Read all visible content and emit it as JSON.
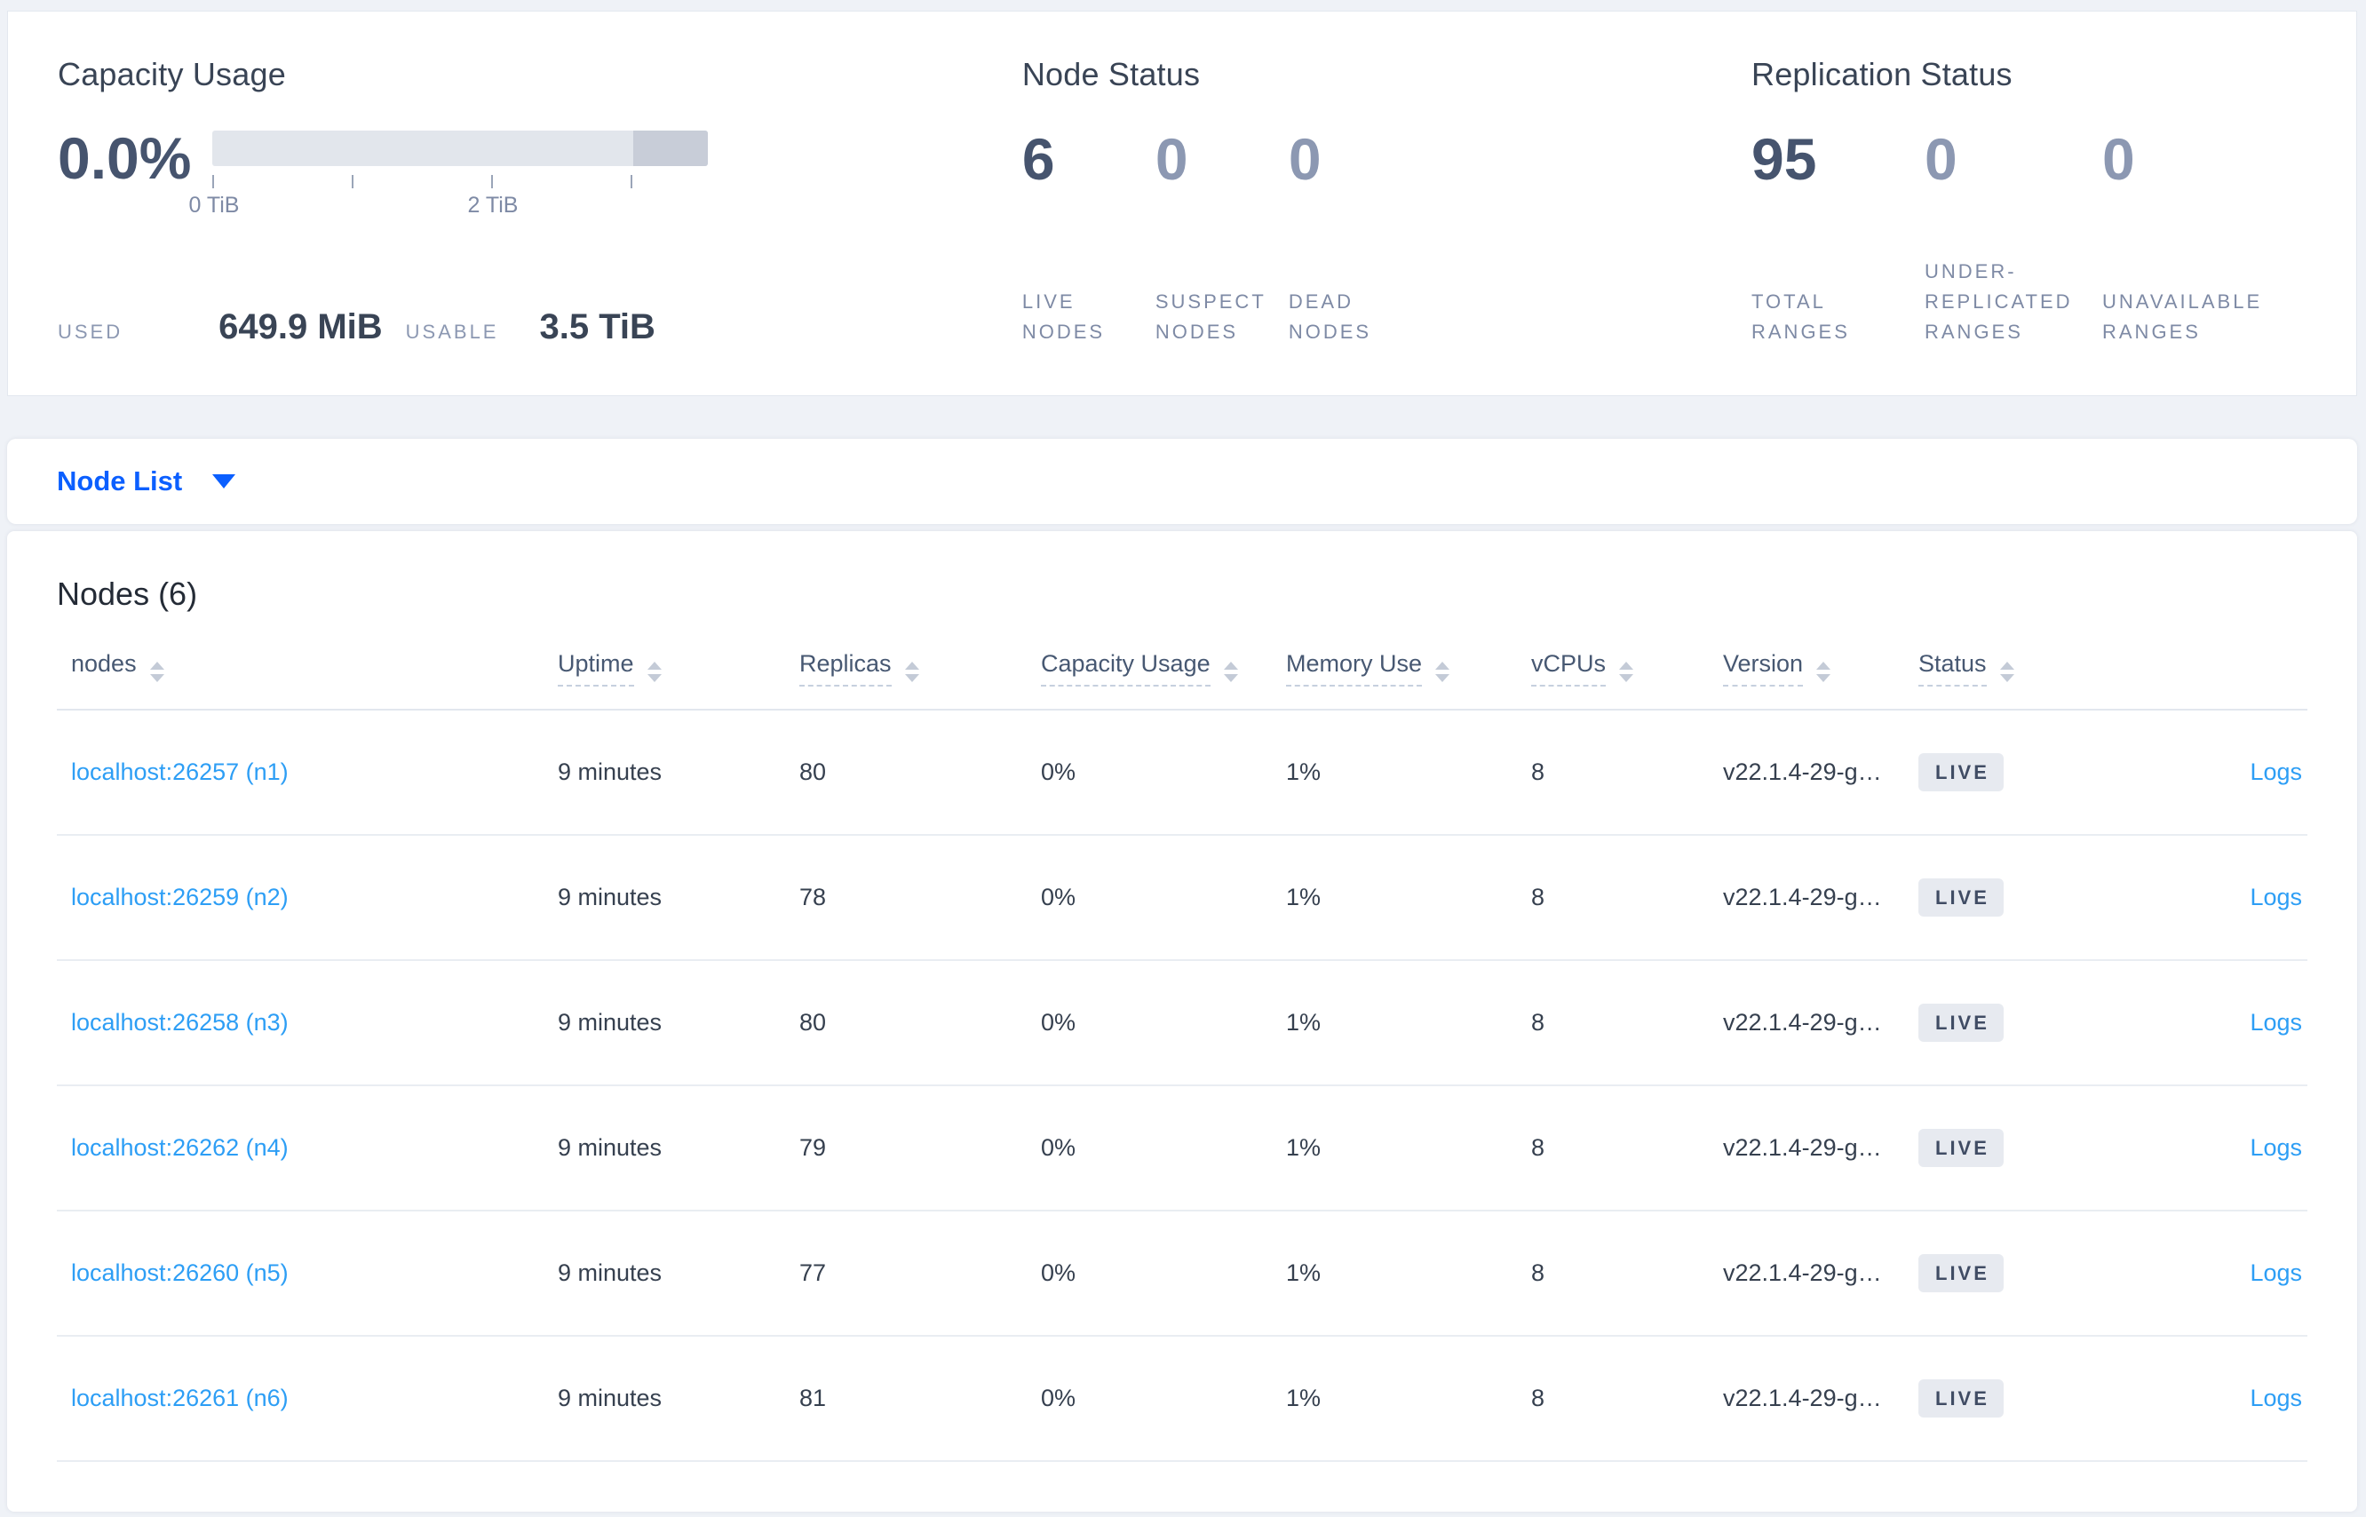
{
  "summary": {
    "capacity": {
      "title": "Capacity Usage",
      "percent": "0.0%",
      "tick_labels": {
        "t0": "0 TiB",
        "t2": "2 TiB"
      },
      "used_label": "USED",
      "used_value": "649.9 MiB",
      "usable_label": "USABLE",
      "usable_value": "3.5 TiB"
    },
    "node_status": {
      "title": "Node Status",
      "stats": [
        {
          "value": "6",
          "label": "LIVE NODES"
        },
        {
          "value": "0",
          "label": "SUSPECT NODES"
        },
        {
          "value": "0",
          "label": "DEAD NODES"
        }
      ]
    },
    "replication": {
      "title": "Replication Status",
      "stats": [
        {
          "value": "95",
          "label": "TOTAL RANGES"
        },
        {
          "value": "0",
          "label": "UNDER-REPLICATED RANGES"
        },
        {
          "value": "0",
          "label": "UNAVAILABLE RANGES"
        }
      ]
    }
  },
  "view_selector": {
    "label": "Node List"
  },
  "table": {
    "title": "Nodes (6)",
    "columns": [
      "nodes",
      "Uptime",
      "Replicas",
      "Capacity Usage",
      "Memory Use",
      "vCPUs",
      "Version",
      "Status"
    ],
    "rows": [
      {
        "node": "localhost:26257 (n1)",
        "uptime": "9 minutes",
        "replicas": "80",
        "capacity": "0%",
        "memory": "1%",
        "vcpus": "8",
        "version": "v22.1.4-29-g…",
        "status": "LIVE",
        "logs": "Logs"
      },
      {
        "node": "localhost:26259 (n2)",
        "uptime": "9 minutes",
        "replicas": "78",
        "capacity": "0%",
        "memory": "1%",
        "vcpus": "8",
        "version": "v22.1.4-29-g…",
        "status": "LIVE",
        "logs": "Logs"
      },
      {
        "node": "localhost:26258 (n3)",
        "uptime": "9 minutes",
        "replicas": "80",
        "capacity": "0%",
        "memory": "1%",
        "vcpus": "8",
        "version": "v22.1.4-29-g…",
        "status": "LIVE",
        "logs": "Logs"
      },
      {
        "node": "localhost:26262 (n4)",
        "uptime": "9 minutes",
        "replicas": "79",
        "capacity": "0%",
        "memory": "1%",
        "vcpus": "8",
        "version": "v22.1.4-29-g…",
        "status": "LIVE",
        "logs": "Logs"
      },
      {
        "node": "localhost:26260 (n5)",
        "uptime": "9 minutes",
        "replicas": "77",
        "capacity": "0%",
        "memory": "1%",
        "vcpus": "8",
        "version": "v22.1.4-29-g…",
        "status": "LIVE",
        "logs": "Logs"
      },
      {
        "node": "localhost:26261 (n6)",
        "uptime": "9 minutes",
        "replicas": "81",
        "capacity": "0%",
        "memory": "1%",
        "vcpus": "8",
        "version": "v22.1.4-29-g…",
        "status": "LIVE",
        "logs": "Logs"
      }
    ]
  },
  "colors": {
    "accent_blue": "#0b5fff",
    "link_blue": "#2d9ef5",
    "heading_slate": "#394455",
    "stat_emphasis": "#46546e",
    "stat_muted": "#8c98b2",
    "label_gray": "#7e8aa5",
    "badge_bg": "#e7eaf0",
    "badge_text": "#404c64",
    "bar_track": "#e2e6ec",
    "bar_extra": "#c8cdd8",
    "page_bg": "#eff2f7"
  }
}
